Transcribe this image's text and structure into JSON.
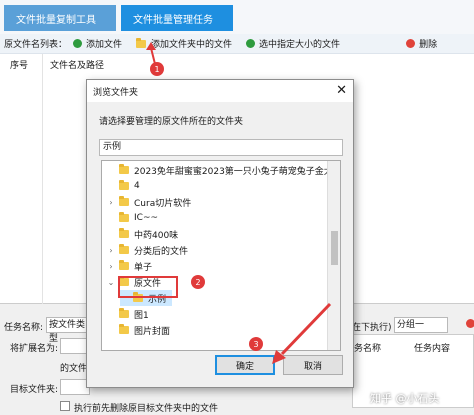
{
  "tabs": [
    "文件批量复制工具",
    "文件批量管理任务"
  ],
  "toolbar": {
    "label": "原文件名列表：",
    "add_file": "添加文件",
    "add_folder_files": "添加文件夹中的文件",
    "select_size": "选中指定大小的文件",
    "delete": "删除"
  },
  "list": {
    "col_no": "序号",
    "col_name": "文件名及路径"
  },
  "bottom": {
    "task_name_label": "任务名称:",
    "task_name_value": "按文件类型",
    "ext_label": "将扩展名为:",
    "files_label": "的文件",
    "target_label": "目标文件夹:",
    "delete_check": "执行前先删除原目标文件夹中的文件",
    "exec_label": "在下执行)",
    "group_value": "分组一",
    "col_task_name": "务名称",
    "col_task_content": "任务内容",
    "watermark": "知乎 @小石头"
  },
  "dialog": {
    "title": "浏览文件夹",
    "close": "✕",
    "prompt": "请选择要管理的原文件所在的文件夹",
    "path_value": "示例",
    "ok": "确定",
    "cancel": "取消",
    "tree": [
      "2023免年甜蜜蜜2023第一只小兔子萌宠兔子金太阳旺",
      "4",
      "Cura切片软件",
      "IC~~",
      "中药400味",
      "分类后的文件",
      "单子",
      "原文件",
      "示例",
      "图1",
      "图片封面"
    ]
  },
  "badges": [
    "1",
    "2",
    "3"
  ]
}
